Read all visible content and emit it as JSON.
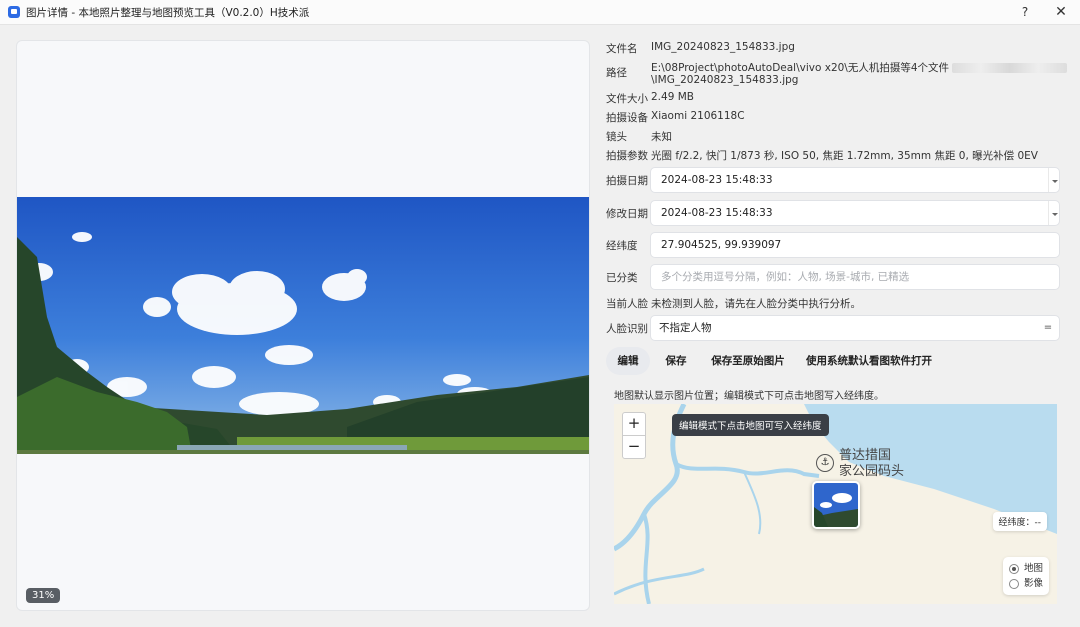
{
  "window": {
    "title": "图片详情 - 本地照片整理与地图预览工具（V0.2.0）H技术派",
    "help": "?",
    "close": "✕"
  },
  "preview": {
    "zoom": "31%"
  },
  "info": {
    "filename_label": "文件名",
    "filename": "IMG_20240823_154833.jpg",
    "path_label": "路径",
    "path_line1": "E:\\08Project\\photoAutoDeal\\vivo x20\\无人机拍摄等4个文件",
    "path_line2": "\\IMG_20240823_154833.jpg",
    "size_label": "文件大小",
    "size": "2.49 MB",
    "device_label": "拍摄设备",
    "device": "Xiaomi 2106118C",
    "lens_label": "镜头",
    "lens": "未知",
    "params_label": "拍摄参数",
    "params": "光圈 f/2.2, 快门 1/873 秒, ISO 50, 焦距 1.72mm, 35mm 焦距 0, 曝光补偿 0EV"
  },
  "fields": {
    "shot_date_label": "拍摄日期",
    "shot_date": "2024-08-23 15:48:33",
    "mod_date_label": "修改日期",
    "mod_date": "2024-08-23 15:48:33",
    "latlng_label": "经纬度",
    "latlng": "27.904525, 99.939097",
    "category_label": "已分类",
    "category_placeholder": "多个分类用逗号分隔，例如：人物, 场景-城市, 已精选",
    "face_label": "当前人脸",
    "face_status": "未检测到人脸，请先在人脸分类中执行分析。",
    "face_id_label": "人脸识别",
    "face_id_value": "不指定人物",
    "face_id_btn": "="
  },
  "toolbar": {
    "edit": "编辑",
    "save": "保存",
    "save_original": "保存至原始图片",
    "open_default": "使用系统默认看图软件打开"
  },
  "map": {
    "hint": "地图默认显示图片位置；编辑模式下可点击地图写入经纬度。",
    "zoom_in": "+",
    "zoom_out": "−",
    "tooltip": "编辑模式下点击地图可写入经纬度",
    "poi_line1": "普达措国",
    "poi_line2": "家公园码头",
    "coord_readout": "经纬度：--",
    "layer_map": "地图",
    "layer_image": "影像",
    "water_color": "#b9dcef",
    "river_color": "#a9d4ec",
    "land_color": "#f6f2e6"
  }
}
